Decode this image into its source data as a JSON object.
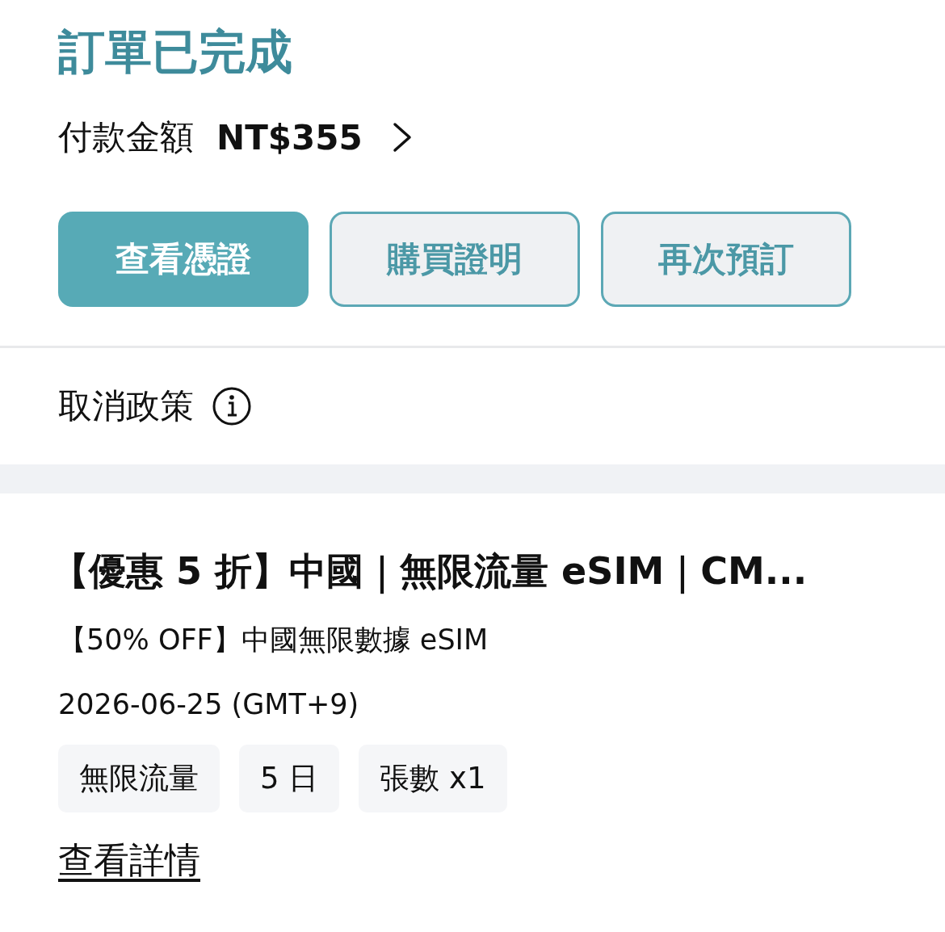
{
  "status": {
    "title": "訂單已完成"
  },
  "payment": {
    "label": "付款金額",
    "amount": "NT$355"
  },
  "buttons": [
    {
      "label": "查看憑證",
      "kind": "primary"
    },
    {
      "label": "購買證明",
      "kind": "secondary"
    },
    {
      "label": "再次預訂",
      "kind": "secondary"
    }
  ],
  "cancel_policy": {
    "label": "取消政策"
  },
  "product": {
    "title": "【優惠 5 折】中國｜無限流量 eSIM｜CM...",
    "subtitle": "【50% OFF】中國無限數據 eSIM",
    "date": "2026-06-25  (GMT+9)",
    "tags": [
      "無限流量",
      "5 日",
      "張數 x1"
    ],
    "link": "查看詳情"
  }
}
